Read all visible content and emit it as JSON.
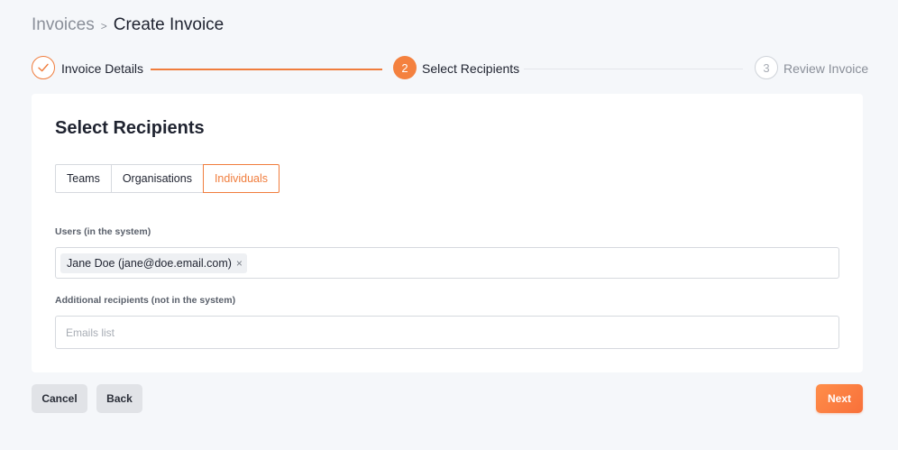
{
  "breadcrumb": {
    "parent": "Invoices",
    "separator": ">",
    "current": "Create Invoice"
  },
  "stepper": {
    "steps": [
      {
        "number": "1",
        "label": "Invoice Details",
        "state": "completed",
        "icon": "check-icon"
      },
      {
        "number": "2",
        "label": "Select Recipients",
        "state": "active"
      },
      {
        "number": "3",
        "label": "Review Invoice",
        "state": "upcoming"
      }
    ]
  },
  "card": {
    "title": "Select Recipients",
    "tabs": [
      {
        "label": "Teams",
        "active": false
      },
      {
        "label": "Organisations",
        "active": false
      },
      {
        "label": "Individuals",
        "active": true
      }
    ],
    "users_label": "Users (in the system)",
    "users_selected": [
      {
        "label": "Jane Doe (jane@doe.email.com)",
        "remove_icon": "close-icon"
      }
    ],
    "additional_label": "Additional recipients (not in the system)",
    "emails_placeholder": "Emails list",
    "emails_value": ""
  },
  "footer": {
    "cancel_label": "Cancel",
    "back_label": "Back",
    "next_label": "Next"
  },
  "colors": {
    "accent": "#f4813f",
    "background": "#f5f7fa",
    "card": "#ffffff",
    "muted_button": "#e1e3e7"
  }
}
